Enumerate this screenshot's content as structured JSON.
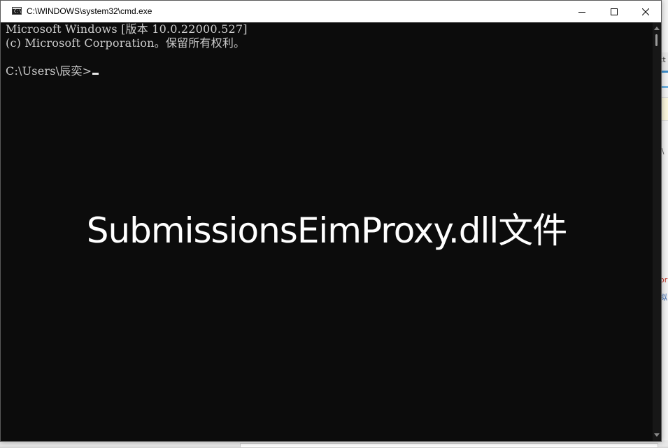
{
  "window": {
    "title": "C:\\WINDOWS\\system32\\cmd.exe",
    "app_icon_label": "C:\\",
    "controls": [
      "minimize",
      "maximize",
      "close"
    ]
  },
  "console": {
    "lines": [
      "Microsoft Windows [版本 10.0.22000.527]",
      "(c) Microsoft Corporation。保留所有权利。",
      "",
      "C:\\Users\\辰奕>"
    ],
    "text_color": "#cccccc",
    "background": "#0c0c0c"
  },
  "overlay": {
    "text": "SubmissionsEimProxy.dll文件"
  },
  "background_app": {
    "fragments": [
      "tt",
      "\\\\",
      "or",
      "拟"
    ]
  },
  "icons": {
    "minimize": "minimize-icon",
    "maximize": "maximize-icon",
    "close": "close-icon"
  }
}
